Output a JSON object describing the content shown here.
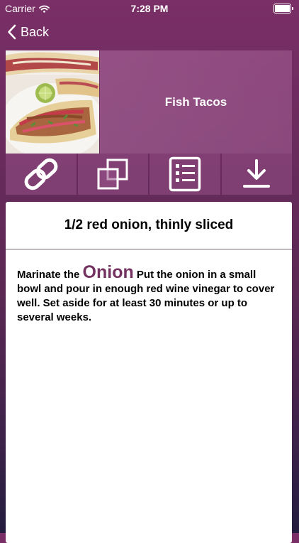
{
  "status_bar": {
    "carrier": "Carrier",
    "time": "7:28 PM",
    "battery_level": 1.0
  },
  "nav": {
    "back_label": "Back"
  },
  "recipe": {
    "title": "Fish Tacos"
  },
  "actions": [
    {
      "icon": "link-icon"
    },
    {
      "icon": "copy-icon"
    },
    {
      "icon": "list-icon"
    },
    {
      "icon": "download-icon"
    }
  ],
  "step": {
    "ingredient": "1/2 red onion, thinly sliced",
    "intro": "Marinate the",
    "keyword": "Onion",
    "instructions": "Put the onion in a small bowl and pour in enough red wine vinegar to cover well. Set aside for at least 30 minutes or up to several weeks."
  },
  "colors": {
    "accent": "#73325f",
    "background_top": "#7a2f66",
    "background_bottom": "#231c3e"
  }
}
